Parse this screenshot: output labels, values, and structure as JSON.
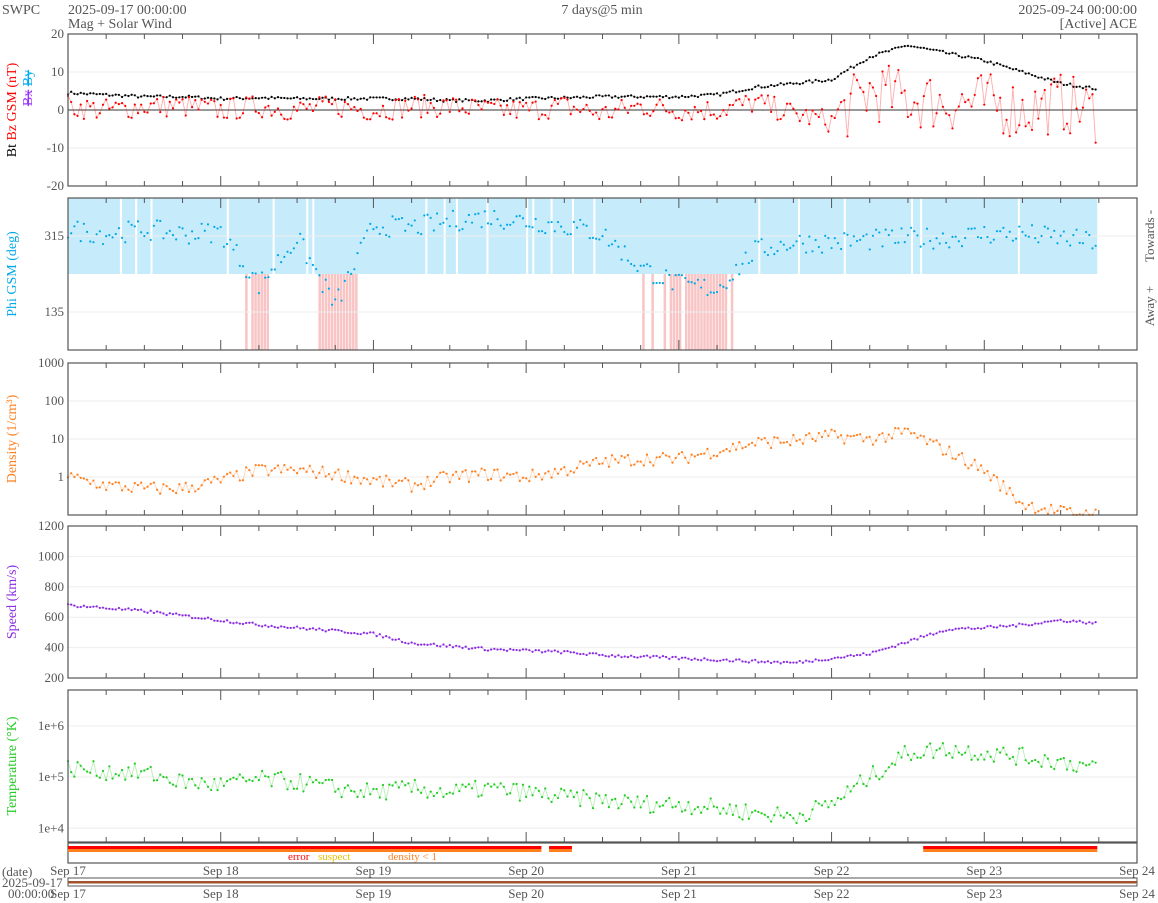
{
  "header": {
    "brand": "SWPC",
    "start": "2025-09-17 00:00:00",
    "subtitle": "Mag + Solar Wind",
    "span": "7 days@5 min",
    "end": "2025-09-24 00:00:00",
    "source": "[Active] ACE"
  },
  "colors": {
    "bt": "#000000",
    "bz": "#ff0000",
    "bx": "#9933ff",
    "by": "#00aaee",
    "phi": "#00a8e8",
    "towards": "#c6ecfb",
    "away": "#f8c4c4",
    "density": "#ff7f1e",
    "speed": "#8a2be2",
    "temperature": "#22cc22",
    "error": "#ff0000",
    "suspect": "#e6c200",
    "density_lt1": "#ff7f1e",
    "datebar": "#a0522d"
  },
  "xaxis": {
    "ticks": [
      "Sep 17",
      "Sep 18",
      "Sep 19",
      "Sep 20",
      "Sep 21",
      "Sep 22",
      "Sep 23",
      "Sep 24"
    ],
    "date_label": "(date)",
    "date_value": "2025-09-17",
    "time_value": "00:00:00"
  },
  "flags": {
    "error": "error",
    "suspect": "suspect",
    "density": "density < 1"
  },
  "chart_data": [
    {
      "type": "line",
      "id": "mag",
      "ylabel_parts": [
        "Bt",
        "Bz GSM (nT)",
        "Bx",
        "By"
      ],
      "ylim": [
        -20,
        20
      ],
      "yticks": [
        "20",
        "10",
        "0",
        "-10",
        "-20"
      ],
      "ytick_values": [
        20,
        10,
        0,
        -10,
        -20
      ],
      "x_days": [
        0,
        0.25,
        0.5,
        0.75,
        1,
        1.25,
        1.5,
        1.75,
        2,
        2.25,
        2.5,
        2.75,
        3,
        3.25,
        3.5,
        3.75,
        4,
        4.25,
        4.5,
        4.75,
        5,
        5.25,
        5.5,
        5.75,
        6,
        6.25,
        6.5,
        6.75
      ],
      "series": [
        {
          "name": "Bt",
          "values": [
            4.5,
            4,
            3.5,
            3.5,
            3,
            3.2,
            3,
            3,
            3,
            3,
            2.5,
            2.5,
            3,
            3.2,
            3.5,
            3.5,
            3.5,
            4,
            6,
            7,
            8,
            14,
            17,
            15,
            13,
            10,
            7,
            5.5
          ]
        },
        {
          "name": "Bz GSM",
          "values": [
            1,
            0,
            1,
            1,
            0,
            1,
            0,
            1,
            0,
            1,
            1,
            0,
            0,
            1,
            -1,
            1,
            0,
            0,
            2,
            -1,
            -3,
            5,
            3,
            2,
            2,
            0,
            2,
            -1
          ]
        }
      ]
    },
    {
      "type": "scatter",
      "id": "phi",
      "ylabel": "Phi GSM (deg)",
      "ylim": [
        45,
        405
      ],
      "yticks": [
        "315",
        "135"
      ],
      "ytick_values": [
        315,
        135
      ],
      "right_labels": [
        "Towards -",
        "Away +"
      ],
      "x_days": [
        0,
        0.25,
        0.5,
        0.75,
        1,
        1.25,
        1.5,
        1.75,
        2,
        2.25,
        2.5,
        2.75,
        3,
        3.25,
        3.5,
        3.75,
        4,
        4.25,
        4.5,
        4.75,
        5,
        5.25,
        5.5,
        5.75,
        6,
        6.25,
        6.5,
        6.75
      ],
      "values": [
        330,
        320,
        330,
        320,
        325,
        200,
        310,
        150,
        340,
        335,
        350,
        360,
        350,
        340,
        320,
        240,
        200,
        190,
        280,
        300,
        300,
        305,
        310,
        310,
        320,
        320,
        310,
        300
      ]
    },
    {
      "type": "line",
      "id": "density",
      "ylabel": "Density (1/cm³)",
      "scale": "log",
      "ylim": [
        0.1,
        1000
      ],
      "yticks": [
        "1000",
        "100",
        "10",
        "1"
      ],
      "ytick_values": [
        1000,
        100,
        10,
        1
      ],
      "x_days": [
        0,
        0.25,
        0.5,
        0.75,
        1,
        1.25,
        1.5,
        1.75,
        2,
        2.25,
        2.5,
        2.75,
        3,
        3.25,
        3.5,
        3.75,
        4,
        4.25,
        4.5,
        4.75,
        5,
        5.25,
        5.5,
        5.75,
        6,
        6.25,
        6.5,
        6.75
      ],
      "values": [
        1,
        0.6,
        0.5,
        0.5,
        0.8,
        1.5,
        1.5,
        1.2,
        0.8,
        0.6,
        1,
        1.2,
        1,
        1.5,
        2.5,
        3,
        3,
        5,
        8,
        9,
        12,
        10,
        15,
        5,
        1.5,
        0.2,
        0.12,
        0.1
      ]
    },
    {
      "type": "line",
      "id": "speed",
      "ylabel": "Speed (km/s)",
      "ylim": [
        200,
        1200
      ],
      "yticks": [
        "1200",
        "1000",
        "800",
        "600",
        "400",
        "200"
      ],
      "ytick_values": [
        1200,
        1000,
        800,
        600,
        400,
        200
      ],
      "x_days": [
        0,
        0.25,
        0.5,
        0.75,
        1,
        1.25,
        1.5,
        1.75,
        2,
        2.25,
        2.5,
        2.75,
        3,
        3.25,
        3.5,
        3.75,
        4,
        4.25,
        4.5,
        4.75,
        5,
        5.25,
        5.5,
        5.75,
        6,
        6.25,
        6.5,
        6.75
      ],
      "values": [
        680,
        660,
        640,
        610,
        580,
        550,
        530,
        510,
        490,
        430,
        410,
        390,
        380,
        370,
        350,
        340,
        330,
        320,
        310,
        300,
        330,
        360,
        440,
        520,
        530,
        550,
        580,
        560
      ]
    },
    {
      "type": "line",
      "id": "temperature",
      "ylabel": "Temperature (°K)",
      "scale": "log",
      "ylim": [
        5400,
        5000000
      ],
      "yticks": [
        "1e+6",
        "1e+5",
        "1e+4"
      ],
      "ytick_values": [
        1000000,
        100000,
        10000
      ],
      "x_days": [
        0,
        0.25,
        0.5,
        0.75,
        1,
        1.25,
        1.5,
        1.75,
        2,
        2.25,
        2.5,
        2.75,
        3,
        3.25,
        3.5,
        3.75,
        4,
        4.25,
        4.5,
        4.75,
        5,
        5.25,
        5.5,
        5.75,
        6,
        6.25,
        6.5,
        6.75
      ],
      "values": [
        150000,
        130000,
        120000,
        80000,
        70000,
        90000,
        80000,
        60000,
        50000,
        60000,
        50000,
        60000,
        50000,
        40000,
        35000,
        30000,
        30000,
        25000,
        20000,
        17000,
        30000,
        100000,
        300000,
        350000,
        300000,
        250000,
        200000,
        150000
      ]
    }
  ]
}
